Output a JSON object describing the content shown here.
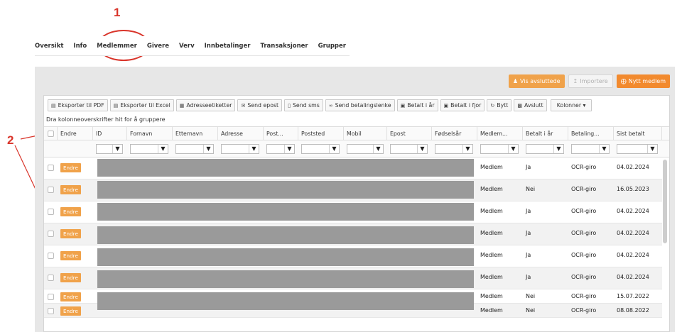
{
  "annotations": {
    "label_one": "1",
    "label_two": "2"
  },
  "nav": {
    "tabs": [
      "Oversikt",
      "Info",
      "Medlemmer",
      "Givere",
      "Verv",
      "Innbetalinger",
      "Transaksjoner",
      "Grupper"
    ],
    "active": "Medlemmer"
  },
  "actions": {
    "show_ended": "Vis avsluttede",
    "import": "Importere",
    "new_member": "Nytt medlem"
  },
  "toolbar": {
    "export_pdf": "Eksporter til PDF",
    "export_excel": "Eksporter til Excel",
    "address_labels": "Adresseetiketter",
    "send_email": "Send epost",
    "send_sms": "Send sms",
    "send_payment_link": "Send betalingslenke",
    "paid_this_year": "Betalt i år",
    "paid_last_year": "Betalt i fjor",
    "swap": "Bytt",
    "end": "Avslutt",
    "columns": "Kolonner ▾"
  },
  "group_hint": "Dra kolonneoverskrifter hit for å gruppere",
  "columns": {
    "endre": "Endre",
    "id": "ID",
    "fornavn": "Fornavn",
    "etternavn": "Etternavn",
    "adresse": "Adresse",
    "post": "Post...",
    "poststed": "Poststed",
    "mobil": "Mobil",
    "epost": "Epost",
    "fodselsar": "Fødselsår",
    "medlem": "Medlem...",
    "betalt": "Betalt i år",
    "betaling": "Betaling...",
    "sist": "Sist betalt"
  },
  "edit_label": "Endre",
  "rows": [
    {
      "type": "Medlem",
      "paid": "Ja",
      "method": "OCR-giro",
      "last": "04.02.2024"
    },
    {
      "type": "Medlem",
      "paid": "Nei",
      "method": "OCR-giro",
      "last": "16.05.2023"
    },
    {
      "type": "Medlem",
      "paid": "Ja",
      "method": "OCR-giro",
      "last": "04.02.2024"
    },
    {
      "type": "Medlem",
      "paid": "Ja",
      "method": "OCR-giro",
      "last": "04.02.2024"
    },
    {
      "type": "Medlem",
      "paid": "Ja",
      "method": "OCR-giro",
      "last": "04.02.2024"
    },
    {
      "type": "Medlem",
      "paid": "Ja",
      "method": "OCR-giro",
      "last": "04.02.2024"
    },
    {
      "type": "Medlem",
      "paid": "Nei",
      "method": "OCR-giro",
      "last": "15.07.2022"
    },
    {
      "type": "Medlem",
      "paid": "Nei",
      "method": "OCR-giro",
      "last": "08.08.2022"
    }
  ],
  "colors": {
    "accent": "#f0a24a",
    "accent_strong": "#f28a2e",
    "annotation": "#d9352b",
    "redaction": "#9a9a9a"
  }
}
